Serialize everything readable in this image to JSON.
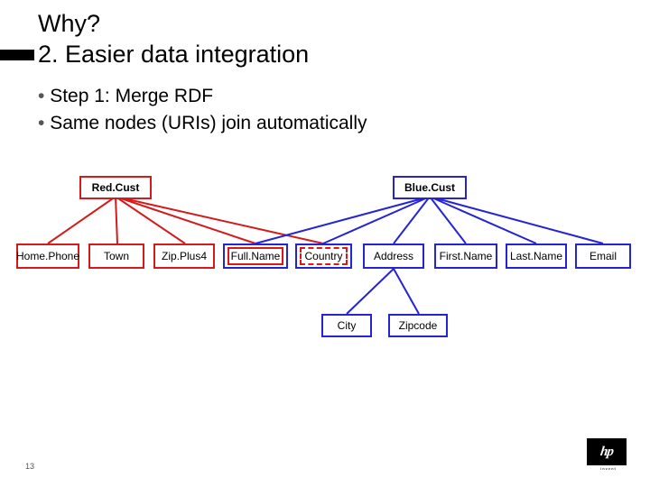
{
  "title_line1": "Why?",
  "title_line2": "2. Easier data integration",
  "bullets": {
    "b1": "Step 1: Merge RDF",
    "b2": "Same nodes (URIs) join automatically"
  },
  "nodes": {
    "redcust": "Red.Cust",
    "bluecust": "Blue.Cust",
    "homephone": "Home.Phone",
    "town": "Town",
    "zipplus4": "Zip.Plus4",
    "fullname": "Full.Name",
    "country": "Country",
    "address": "Address",
    "firstname": "First.Name",
    "lastname": "Last.Name",
    "email": "Email",
    "city": "City",
    "zipcode": "Zipcode"
  },
  "page_number": "13",
  "logo": {
    "label": "hp",
    "tag": "invent"
  },
  "colors": {
    "red": "#d41b1b",
    "blue": "#2424d6"
  }
}
